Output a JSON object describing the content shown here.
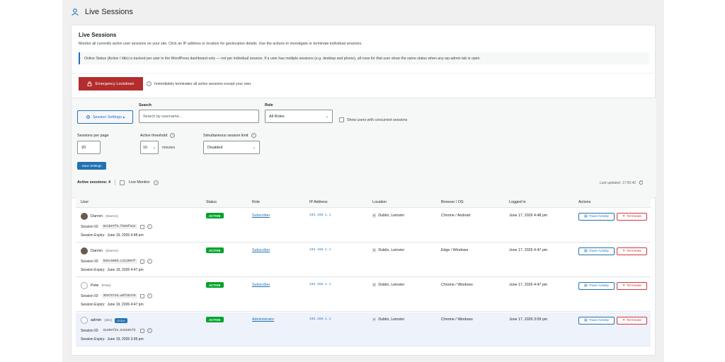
{
  "header": {
    "title": "Live Sessions"
  },
  "panel": {
    "heading": "Live Sessions",
    "description": "Monitor all currently active user sessions on your site. Click an IP address or location for geolocation details. Use the actions to investigate or terminate individual sessions.",
    "notice": "Online Status (Active / Idle) is tracked per user in the WordPress dashboard only — not per individual session. If a user has multiple sessions (e.g. desktop and phone), all rows for that user show the same status when any wp-admin tab is open."
  },
  "lockdown": {
    "button_label": "Emergency Lockdown",
    "note": "Immediately terminates all active sessions except your own."
  },
  "filters": {
    "settings_button": "Session Settings ▴",
    "search_label": "Search",
    "search_placeholder": "Search by username...",
    "role_label": "Role",
    "role_value": "All Roles",
    "concurrent_label": "Show users with concurrent sessions"
  },
  "settings": {
    "per_page_label": "Sessions per page",
    "per_page_value": "20",
    "threshold_label": "Active threshold",
    "threshold_value": "10",
    "threshold_unit": "minutes",
    "limit_label": "Simultaneous session limit",
    "limit_value": "Disabled",
    "save_label": "Save Settings"
  },
  "summary": {
    "active_sessions": "Active sessions: 4",
    "live_monitor": "Live Monitor",
    "last_updated": "Last updated: 17:50:42"
  },
  "table": {
    "columns": [
      "User",
      "Status",
      "Role",
      "IP Address",
      "Location",
      "Browser / OS",
      "Logged In",
      "Actions"
    ],
    "session_id_label": "Session ID:",
    "expiry_label": "Session Expiry:",
    "trace_label": "Trace Activity",
    "terminate_label": "Terminate",
    "rows": [
      {
        "name": "Darren",
        "short": "(Darren)",
        "badge": "",
        "session_id": "0e1b07f5…f569f842",
        "expiry": "June 19, 2026 4:48 pm",
        "status": "ACTIVE",
        "role": "Subscriber",
        "ip": "192.168.1.1",
        "flag": "IE",
        "location": "Dublin, Leinster",
        "browser": "Chrome / Android",
        "logged_in": "June 17, 2026 4:48 pm",
        "avatar": "photo"
      },
      {
        "name": "Darren",
        "short": "(Darren)",
        "badge": "",
        "session_id": "595c5069…c112007f",
        "expiry": "June 19, 2026 4:47 pm",
        "status": "ACTIVE",
        "role": "Subscriber",
        "ip": "192.168.1.1",
        "flag": "IE",
        "location": "Dublin, Leinster",
        "browser": "Edge / Windows",
        "logged_in": "June 17, 2026 4:47 pm",
        "avatar": "photo"
      },
      {
        "name": "Pete",
        "short": "(Pete)",
        "badge": "",
        "session_id": "3b87572d…a0f4b470",
        "expiry": "June 19, 2026 4:47 pm",
        "status": "ACTIVE",
        "role": "Subscriber",
        "ip": "192.168.1.1",
        "flag": "IE",
        "location": "Dublin, Leinster",
        "browser": "Chrome / Windows",
        "logged_in": "June 17, 2026 4:47 pm",
        "avatar": "default"
      },
      {
        "name": "admin",
        "short": "(dev)",
        "badge": "(YOU)",
        "session_id": "61808fde…815695fd",
        "expiry": "June 19, 2026 3:09 pm",
        "status": "ACTIVE",
        "role": "Administrator",
        "ip": "192.168.1.1",
        "flag": "IE",
        "location": "Dublin, Leinster",
        "browser": "Chrome / Windows",
        "logged_in": "June 17, 2026 3:09 pm",
        "avatar": "default"
      }
    ]
  },
  "colors": {
    "accent": "#2271b1",
    "danger": "#b32d2e",
    "active": "#00a32a",
    "highlight_row": "#eef2fb"
  },
  "icons": [
    "user-icon",
    "lock-icon",
    "help-icon",
    "gear-icon",
    "refresh-icon",
    "copy-icon",
    "trace-icon",
    "close-icon",
    "chevron-down-icon",
    "checkbox-icon"
  ]
}
